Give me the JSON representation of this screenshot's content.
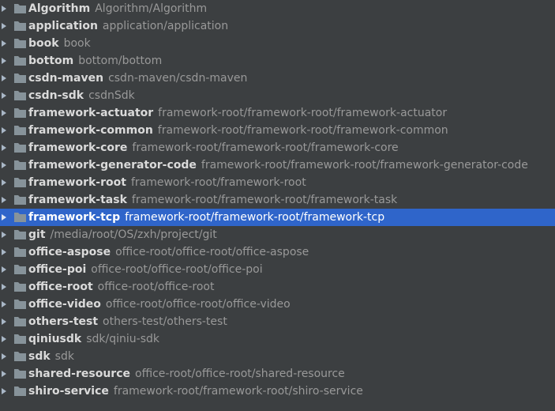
{
  "colors": {
    "background": "#3c3f41",
    "selection": "#2f65ca",
    "module_name": "#dadada",
    "module_path": "#999999",
    "folder_icon": "#87939a"
  },
  "modules": [
    {
      "name": "Algorithm",
      "path": "Algorithm/Algorithm",
      "selected": false
    },
    {
      "name": "application",
      "path": "application/application",
      "selected": false
    },
    {
      "name": "book",
      "path": "book",
      "selected": false
    },
    {
      "name": "bottom",
      "path": "bottom/bottom",
      "selected": false
    },
    {
      "name": "csdn-maven",
      "path": "csdn-maven/csdn-maven",
      "selected": false
    },
    {
      "name": "csdn-sdk",
      "path": "csdnSdk",
      "selected": false
    },
    {
      "name": "framework-actuator",
      "path": "framework-root/framework-root/framework-actuator",
      "selected": false
    },
    {
      "name": "framework-common",
      "path": "framework-root/framework-root/framework-common",
      "selected": false
    },
    {
      "name": "framework-core",
      "path": "framework-root/framework-root/framework-core",
      "selected": false
    },
    {
      "name": "framework-generator-code",
      "path": "framework-root/framework-root/framework-generator-code",
      "selected": false
    },
    {
      "name": "framework-root",
      "path": "framework-root/framework-root",
      "selected": false
    },
    {
      "name": "framework-task",
      "path": "framework-root/framework-root/framework-task",
      "selected": false
    },
    {
      "name": "framework-tcp",
      "path": "framework-root/framework-root/framework-tcp",
      "selected": true
    },
    {
      "name": "git",
      "path": "/media/root/OS/zxh/project/git",
      "selected": false
    },
    {
      "name": "office-aspose",
      "path": "office-root/office-root/office-aspose",
      "selected": false
    },
    {
      "name": "office-poi",
      "path": "office-root/office-root/office-poi",
      "selected": false
    },
    {
      "name": "office-root",
      "path": "office-root/office-root",
      "selected": false
    },
    {
      "name": "office-video",
      "path": "office-root/office-root/office-video",
      "selected": false
    },
    {
      "name": "others-test",
      "path": "others-test/others-test",
      "selected": false
    },
    {
      "name": "qiniusdk",
      "path": "sdk/qiniu-sdk",
      "selected": false
    },
    {
      "name": "sdk",
      "path": "sdk",
      "selected": false
    },
    {
      "name": "shared-resource",
      "path": "office-root/office-root/shared-resource",
      "selected": false
    },
    {
      "name": "shiro-service",
      "path": "framework-root/framework-root/shiro-service",
      "selected": false
    }
  ]
}
